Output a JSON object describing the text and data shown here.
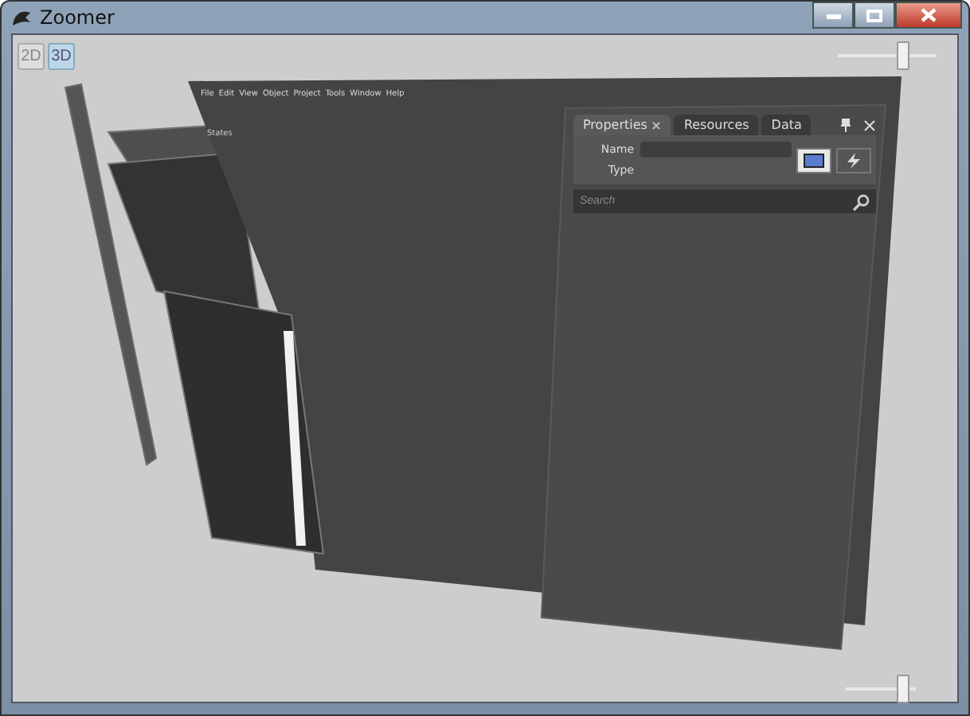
{
  "window": {
    "title": "Zoomer"
  },
  "view_modes": [
    {
      "label": "2D",
      "selected": false
    },
    {
      "label": "3D",
      "selected": true
    }
  ],
  "zoom_slider": {
    "level": 0.65
  },
  "scene": {
    "menu": [
      "File",
      "Edit",
      "View",
      "Object",
      "Project",
      "Tools",
      "Window",
      "Help"
    ],
    "side_tabs": [
      {
        "label": "States"
      }
    ],
    "properties_panel": {
      "tabs": [
        {
          "label": "Properties",
          "selected": true,
          "closable": true
        },
        {
          "label": "Resources",
          "selected": false,
          "closable": false
        },
        {
          "label": "Data",
          "selected": false,
          "closable": false
        }
      ],
      "fields": [
        "Name",
        "Type"
      ],
      "search": {
        "placeholder": "Search"
      }
    }
  },
  "bottom_slider": {
    "level": 0.8
  }
}
